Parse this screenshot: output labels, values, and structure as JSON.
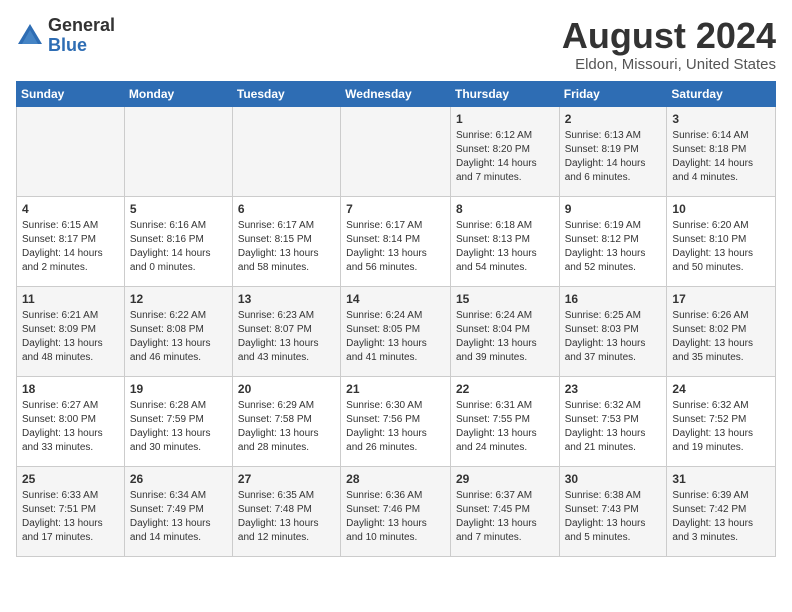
{
  "logo": {
    "general": "General",
    "blue": "Blue"
  },
  "header": {
    "month_year": "August 2024",
    "location": "Eldon, Missouri, United States"
  },
  "days_of_week": [
    "Sunday",
    "Monday",
    "Tuesday",
    "Wednesday",
    "Thursday",
    "Friday",
    "Saturday"
  ],
  "weeks": [
    [
      {
        "day": "",
        "content": ""
      },
      {
        "day": "",
        "content": ""
      },
      {
        "day": "",
        "content": ""
      },
      {
        "day": "",
        "content": ""
      },
      {
        "day": "1",
        "content": "Sunrise: 6:12 AM\nSunset: 8:20 PM\nDaylight: 14 hours\nand 7 minutes."
      },
      {
        "day": "2",
        "content": "Sunrise: 6:13 AM\nSunset: 8:19 PM\nDaylight: 14 hours\nand 6 minutes."
      },
      {
        "day": "3",
        "content": "Sunrise: 6:14 AM\nSunset: 8:18 PM\nDaylight: 14 hours\nand 4 minutes."
      }
    ],
    [
      {
        "day": "4",
        "content": "Sunrise: 6:15 AM\nSunset: 8:17 PM\nDaylight: 14 hours\nand 2 minutes."
      },
      {
        "day": "5",
        "content": "Sunrise: 6:16 AM\nSunset: 8:16 PM\nDaylight: 14 hours\nand 0 minutes."
      },
      {
        "day": "6",
        "content": "Sunrise: 6:17 AM\nSunset: 8:15 PM\nDaylight: 13 hours\nand 58 minutes."
      },
      {
        "day": "7",
        "content": "Sunrise: 6:17 AM\nSunset: 8:14 PM\nDaylight: 13 hours\nand 56 minutes."
      },
      {
        "day": "8",
        "content": "Sunrise: 6:18 AM\nSunset: 8:13 PM\nDaylight: 13 hours\nand 54 minutes."
      },
      {
        "day": "9",
        "content": "Sunrise: 6:19 AM\nSunset: 8:12 PM\nDaylight: 13 hours\nand 52 minutes."
      },
      {
        "day": "10",
        "content": "Sunrise: 6:20 AM\nSunset: 8:10 PM\nDaylight: 13 hours\nand 50 minutes."
      }
    ],
    [
      {
        "day": "11",
        "content": "Sunrise: 6:21 AM\nSunset: 8:09 PM\nDaylight: 13 hours\nand 48 minutes."
      },
      {
        "day": "12",
        "content": "Sunrise: 6:22 AM\nSunset: 8:08 PM\nDaylight: 13 hours\nand 46 minutes."
      },
      {
        "day": "13",
        "content": "Sunrise: 6:23 AM\nSunset: 8:07 PM\nDaylight: 13 hours\nand 43 minutes."
      },
      {
        "day": "14",
        "content": "Sunrise: 6:24 AM\nSunset: 8:05 PM\nDaylight: 13 hours\nand 41 minutes."
      },
      {
        "day": "15",
        "content": "Sunrise: 6:24 AM\nSunset: 8:04 PM\nDaylight: 13 hours\nand 39 minutes."
      },
      {
        "day": "16",
        "content": "Sunrise: 6:25 AM\nSunset: 8:03 PM\nDaylight: 13 hours\nand 37 minutes."
      },
      {
        "day": "17",
        "content": "Sunrise: 6:26 AM\nSunset: 8:02 PM\nDaylight: 13 hours\nand 35 minutes."
      }
    ],
    [
      {
        "day": "18",
        "content": "Sunrise: 6:27 AM\nSunset: 8:00 PM\nDaylight: 13 hours\nand 33 minutes."
      },
      {
        "day": "19",
        "content": "Sunrise: 6:28 AM\nSunset: 7:59 PM\nDaylight: 13 hours\nand 30 minutes."
      },
      {
        "day": "20",
        "content": "Sunrise: 6:29 AM\nSunset: 7:58 PM\nDaylight: 13 hours\nand 28 minutes."
      },
      {
        "day": "21",
        "content": "Sunrise: 6:30 AM\nSunset: 7:56 PM\nDaylight: 13 hours\nand 26 minutes."
      },
      {
        "day": "22",
        "content": "Sunrise: 6:31 AM\nSunset: 7:55 PM\nDaylight: 13 hours\nand 24 minutes."
      },
      {
        "day": "23",
        "content": "Sunrise: 6:32 AM\nSunset: 7:53 PM\nDaylight: 13 hours\nand 21 minutes."
      },
      {
        "day": "24",
        "content": "Sunrise: 6:32 AM\nSunset: 7:52 PM\nDaylight: 13 hours\nand 19 minutes."
      }
    ],
    [
      {
        "day": "25",
        "content": "Sunrise: 6:33 AM\nSunset: 7:51 PM\nDaylight: 13 hours\nand 17 minutes."
      },
      {
        "day": "26",
        "content": "Sunrise: 6:34 AM\nSunset: 7:49 PM\nDaylight: 13 hours\nand 14 minutes."
      },
      {
        "day": "27",
        "content": "Sunrise: 6:35 AM\nSunset: 7:48 PM\nDaylight: 13 hours\nand 12 minutes."
      },
      {
        "day": "28",
        "content": "Sunrise: 6:36 AM\nSunset: 7:46 PM\nDaylight: 13 hours\nand 10 minutes."
      },
      {
        "day": "29",
        "content": "Sunrise: 6:37 AM\nSunset: 7:45 PM\nDaylight: 13 hours\nand 7 minutes."
      },
      {
        "day": "30",
        "content": "Sunrise: 6:38 AM\nSunset: 7:43 PM\nDaylight: 13 hours\nand 5 minutes."
      },
      {
        "day": "31",
        "content": "Sunrise: 6:39 AM\nSunset: 7:42 PM\nDaylight: 13 hours\nand 3 minutes."
      }
    ]
  ]
}
